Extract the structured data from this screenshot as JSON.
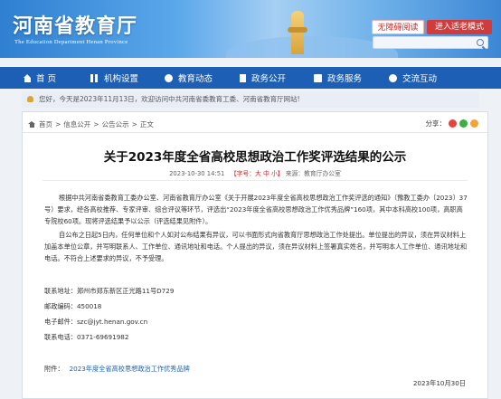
{
  "header": {
    "logo_cn": "河南省教育厅",
    "logo_en": "The Education Department Henan Province",
    "btn_accessible": "无障碍阅读",
    "btn_elder": "进入适老模式",
    "search_placeholder": ""
  },
  "nav": {
    "items": [
      {
        "label": "首 页",
        "icon": "home-icon"
      },
      {
        "label": "机构设置",
        "icon": "org-icon"
      },
      {
        "label": "教育动态",
        "icon": "news-icon"
      },
      {
        "label": "政务公开",
        "icon": "doc-icon"
      },
      {
        "label": "政务服务",
        "icon": "service-icon"
      },
      {
        "label": "交流互动",
        "icon": "chat-icon"
      }
    ]
  },
  "notice": "您好，今天是2023年11月13日，欢迎访问中共河南省委教育工委、河南省教育厅网站!",
  "breadcrumb": {
    "items": [
      "首页",
      "信息公开",
      "公告公示",
      "正文"
    ],
    "separator": ">",
    "share_label": "分享："
  },
  "article": {
    "title": "关于2023年度全省高校思想政治工作奖评选结果的公示",
    "date": "2023-10-30 14:51",
    "font_label": "【字号：",
    "font_sizes": "大 中 小",
    "font_close": "】",
    "source": "来源：教育厅办公室",
    "para1": "根据中共河南省委教育工委办公室、河南省教育厅办公室《关于开展2023年度全省高校思想政治工作奖评选的通知》（豫教工委办〔2023〕37号）要求，经各高校推荐、专家评审、综合评议等环节，评选出“2023年度全省高校思想政治工作优秀品牌”160项，其中本科高校100项，高职高专院校60项。现将评选结果予以公示（评选结果见附件）。",
    "para2": "自公布之日起5日内，任何单位和个人如对公布结果有异议，可以书面形式向省教育厅思想政治工作处提出。单位提出的异议，须在异议材料上加盖本单位公章，并写明联系人、工作单位、通讯地址和电话。个人提出的异议，须在异议材料上签署真实姓名，并写明本人工作单位、通讯地址和电话。不符合上述要求的异议，不予受理。",
    "contact_address": "联系地址：郑州市郑东新区正光路11号D729",
    "contact_zip": "邮政编码：450018",
    "contact_email": "电子邮件：szc@jyt.henan.gov.cn",
    "contact_phone": "联系电话：0371-69691982",
    "attachment_label": "附件：",
    "attachment_link": "2023年度全省高校思想政治工作优秀品牌",
    "sign_date": "2023年10月30日"
  },
  "colors": {
    "nav_bg": "#1d5fb4",
    "accent_red": "#d13b3b"
  }
}
